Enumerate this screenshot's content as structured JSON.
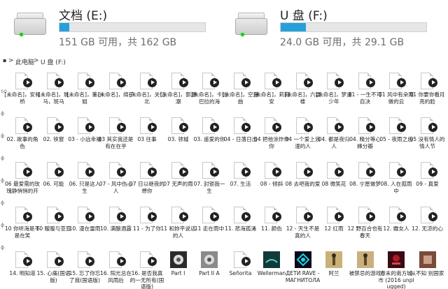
{
  "drives": [
    {
      "title": "文档 (E:)",
      "space": "151 GB 可用，共 162 GB",
      "used_fraction": 0.068,
      "fill_color": "#26a0da"
    },
    {
      "title": "U 盘 (F:)",
      "space": "24.0 GB 可用，共 29.1 GB",
      "used_fraction": 0.175,
      "fill_color": "#26a0da"
    }
  ],
  "breadcrumb": {
    "root": "此电脑",
    "sep": ">",
    "current": "U 盘 (F:)"
  },
  "gutter": [
    "so",
    "ϕ",
    "ϕ",
    "ϕ",
    "ϕ",
    "ϕ",
    "ϕ",
    "ϕ"
  ],
  "files": [
    [
      "[未命名]，安和桥",
      "[未命名]，斑马，斑马",
      "[未命名]，董小姐",
      "[未命名]，绵子",
      "[未命名]，关忆北",
      "[未命名]，郭源潮",
      "[未命名]，卡比巴拉的海",
      "[未命名]，空港曲",
      "[未命名]，莉莉安",
      "[未命名]，六层楼",
      "[未命名]，梦速少年",
      "01 - 一生不可自决",
      "01 风中有朵雨做的云",
      "01 你要你看月亮的脸"
    ],
    [
      "02. 故事的角色",
      "02. 铁窗",
      "03 - 小远幸福",
      "03 其实我还是有在在乎",
      "03 往事",
      "03. 领城",
      "03. 遥爱的你",
      "04 - 日落日出",
      "04 把他涂炸作你",
      "04 一个爱上浪漫的人",
      "04. 都是夜归人",
      "04. 精分等心蜂分瓣",
      "05 - 夜雨之后",
      "05 没有情人的情人节"
    ],
    [
      "06 最爱需的玫瑰静悄悄的开",
      "06. 可能",
      "06. 只是这人生",
      "07 - 风中伤心人",
      "07 日以继夜的想你",
      "07 无声的雨",
      "07. 封锁我一生",
      "07. 生活",
      "08 - 倾斜",
      "08 去吧我的爱",
      "08 微笑花",
      "08. 宁愿做梦",
      "08. 人在孤雨中",
      "09 - 真爱"
    ],
    [
      "10 你听海是不是在笑",
      "10 暧暧与亚亚",
      "10. 漫在雷雨",
      "10. 满酿酒露",
      "11 - 为了你",
      "11 和妳平说话的人",
      "11 走在雨中",
      "11. 悲海孤涌",
      "11. 颜色",
      "12 - 天生不是真的人",
      "12 红雨",
      "12 野百合也有春天",
      "12. 嫐女人",
      "12. 无凉的心"
    ],
    [
      "14. 明知道",
      "15. 心痛(国语版)",
      "15. 忘了你忘了我(国语版)",
      "16. 阳光总在风雨后",
      "16. 是否我真的一无所有(国语版)",
      "Part I",
      "Part II A",
      "Señorita",
      "Wellerman",
      "ДЕТИ RAVE - МАГНИТОЛА",
      "阿兰",
      "被禁忌的游戏",
      "春末的南方城市 (2016 unplugged)",
      "从不知 别国家"
    ]
  ],
  "thumb_colors": {
    "part1": "#2b2b2b",
    "part2": "#8a8a8a",
    "wellerman": "#123a3a",
    "deti": "#0a0a1a",
    "alan": "#c8b27a",
    "jinji": "#c9b07e",
    "chunmo": "#3b0a12",
    "congbuzhi": "#7a4a3a"
  }
}
